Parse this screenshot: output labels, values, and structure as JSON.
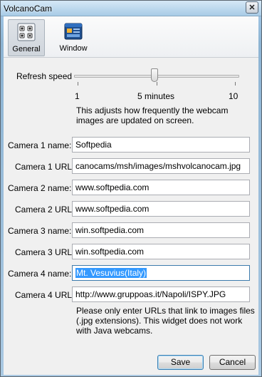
{
  "window": {
    "title": "VolcanoCam",
    "close_symbol": "✕"
  },
  "toolbar": {
    "general_label": "General",
    "window_label": "Window"
  },
  "refresh": {
    "label": "Refresh speed",
    "min_label": "1",
    "mid_label": "5 minutes",
    "max_label": "10",
    "value_fraction": 0.49,
    "help_line1": "This adjusts how frequently the webcam",
    "help_line2": "images are updated on screen."
  },
  "cameras": [
    {
      "name_label": "Camera 1 name:",
      "name_value": "Softpedia",
      "url_label": "Camera 1 URL:",
      "url_value": "canocams/msh/images/mshvolcanocam.jpg"
    },
    {
      "name_label": "Camera 2 name:",
      "name_value": "www.softpedia.com",
      "url_label": "Camera 2 URL:",
      "url_value": "www.softpedia.com"
    },
    {
      "name_label": "Camera 3 name:",
      "name_value": "win.softpedia.com",
      "url_label": "Camera 3 URL:",
      "url_value": "win.softpedia.com"
    },
    {
      "name_label": "Camera 4 name:",
      "name_value": "Mt. Vesuvius(Italy)",
      "url_label": "Camera 4 URL:",
      "url_value": "http://www.gruppoas.it/Napoli/ISPY.JPG"
    }
  ],
  "url_help": {
    "line1": "Please only enter URLs that link to images files",
    "line2": "(.jpg extensions). This widget does not work",
    "line3": "with Java webcams."
  },
  "buttons": {
    "save": "Save",
    "cancel": "Cancel"
  }
}
